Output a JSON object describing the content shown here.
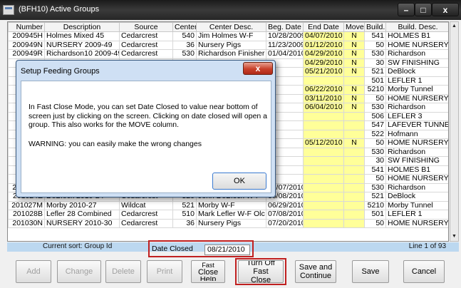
{
  "window": {
    "title": "(BFH10)  Active Groups"
  },
  "grid": {
    "columns": [
      "Number",
      "Description",
      "Source",
      "Center",
      "Center Desc.",
      "Beg. Date",
      "End Date",
      "Move",
      "Build.",
      "Build. Desc."
    ],
    "rows": [
      [
        "200945H",
        "Holmes Mixed 45",
        "Cedarcrest",
        "540",
        "Jim Holmes W-F",
        "10/28/2009",
        "04/07/2010",
        "N",
        "541",
        "HOLMES B1"
      ],
      [
        "200949N",
        "NURSERY 2009-49",
        "Cedarcrest",
        "36",
        "Nursery Pigs",
        "11/23/2009",
        "01/12/2010",
        "N",
        "50",
        "HOME NURSERY"
      ],
      [
        "200949R",
        "Richardson10 2009-49",
        "Cedarcrest",
        "530",
        "Richardson Finisher",
        "01/04/2010",
        "04/29/2010",
        "N",
        "530",
        "Richardson"
      ],
      [
        "",
        "",
        "",
        "",
        "",
        "",
        "04/29/2010",
        "N",
        "30",
        "SW FINISHING"
      ],
      [
        "",
        "",
        "",
        "",
        "",
        "",
        "05/21/2010",
        "N",
        "521",
        "DeBlock"
      ],
      [
        "",
        "",
        "",
        "",
        "",
        "",
        "",
        "",
        "501",
        "LEFLER 1"
      ],
      [
        "",
        "",
        "",
        "",
        "",
        "",
        "06/22/2010",
        "N",
        "5210",
        "Morby Tunnel"
      ],
      [
        "",
        "",
        "",
        "",
        "",
        "",
        "03/11/2010",
        "N",
        "50",
        "HOME NURSERY"
      ],
      [
        "",
        "",
        "",
        "",
        "",
        "",
        "06/04/2010",
        "N",
        "530",
        "Richardson"
      ],
      [
        "",
        "",
        "",
        "",
        "",
        "",
        "",
        "",
        "506",
        "LEFLER 3"
      ],
      [
        "",
        "",
        "",
        "",
        "",
        "",
        "",
        "",
        "547",
        "LAFEVER TUNNE"
      ],
      [
        "",
        "",
        "",
        "",
        "",
        "",
        "",
        "",
        "522",
        "Hofmann"
      ],
      [
        "",
        "",
        "",
        "",
        "",
        "",
        "05/12/2010",
        "N",
        "50",
        "HOME NURSERY"
      ],
      [
        "",
        "",
        "",
        "",
        "",
        "",
        "",
        "",
        "530",
        "Richardson"
      ],
      [
        "",
        "",
        "",
        "",
        "",
        "",
        "",
        "",
        "30",
        "SW FINISHING"
      ],
      [
        "",
        "",
        "",
        "",
        "",
        "",
        "",
        "",
        "541",
        "HOLMES B1"
      ],
      [
        "",
        "",
        "",
        "",
        "",
        "",
        "",
        "",
        "50",
        "HOME NURSERY"
      ],
      [
        "201022R",
        "Richardson5 2010-22",
        "Cedarcrest",
        "530",
        "Richardson Finisher",
        "07/07/2010",
        "",
        "",
        "530",
        "Richardson"
      ],
      [
        "201024E",
        "DeBlock 2010-24",
        "Cedarcrest",
        "520",
        "John DeBlock W-F",
        "06/08/2010",
        "",
        "",
        "521",
        "DeBlock"
      ],
      [
        "201027M",
        "Morby 2010-27",
        "Wildcat",
        "521",
        "Morby W-F",
        "06/29/2010",
        "",
        "",
        "5210",
        "Morby Tunnel"
      ],
      [
        "201028B",
        "Lefler 28 Combined",
        "Cedarcrest",
        "510",
        "Mark Lefler W-F Olc",
        "07/08/2010",
        "",
        "",
        "501",
        "LEFLER 1"
      ],
      [
        "201030N",
        "NURSERY 2010-30",
        "Cedarcrest",
        "36",
        "Nursery Pigs",
        "07/20/2010",
        "",
        "",
        "50",
        "HOME NURSERY"
      ]
    ]
  },
  "statusbar": {
    "sort": "Current sort:  Group Id",
    "line": "Line   1 of 93"
  },
  "date_closed": {
    "label": "Date Closed",
    "value": "08/21/2010"
  },
  "buttons": {
    "add": "Add",
    "change": "Change",
    "delete": "Delete",
    "print": "Print",
    "fast_close": [
      "Fast",
      "Close",
      "Help"
    ],
    "turn_off": [
      "Turn Off Fast",
      "Close"
    ],
    "save_continue": [
      "Save and",
      "Continue"
    ],
    "save": "Save",
    "cancel": "Cancel"
  },
  "dialog": {
    "title": "Setup Feeding Groups",
    "message": "In Fast Close Mode, you can set Date Closed to value near bottom of screen just by clicking on the screen.  Clicking on date closed will open a group. This also works for the MOVE column.",
    "warning": "WARNING:  you can easily make the wrong changes",
    "ok": "OK"
  }
}
